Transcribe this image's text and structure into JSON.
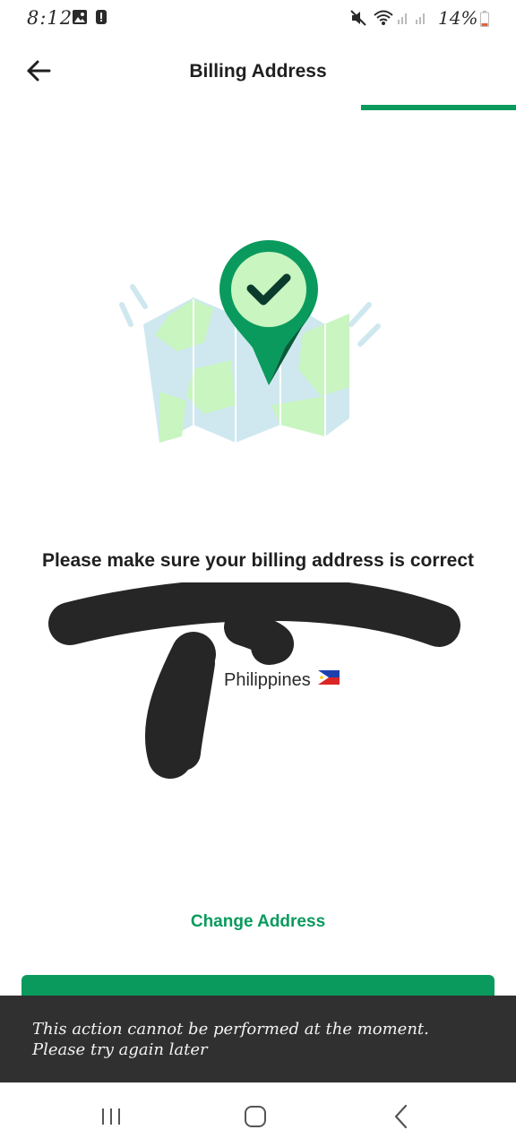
{
  "status_bar": {
    "time": "8:12",
    "battery": "14%"
  },
  "header": {
    "title": "Billing Address",
    "progress": 0.3
  },
  "content": {
    "prompt": "Please make sure your billing address is correct",
    "address_country": "Philippines",
    "change_label": "Change Address"
  },
  "toast": {
    "message": "This action cannot be performed at the moment. Please try again later"
  },
  "colors": {
    "accent": "#0a9a5d",
    "toast_bg": "#303030"
  },
  "icons": [
    "back-arrow-icon",
    "photo-icon",
    "alert-icon",
    "mute-icon",
    "wifi-icon",
    "signal-icon",
    "battery-icon",
    "recent-apps-icon",
    "home-icon",
    "nav-back-icon",
    "philippines-flag-icon"
  ]
}
